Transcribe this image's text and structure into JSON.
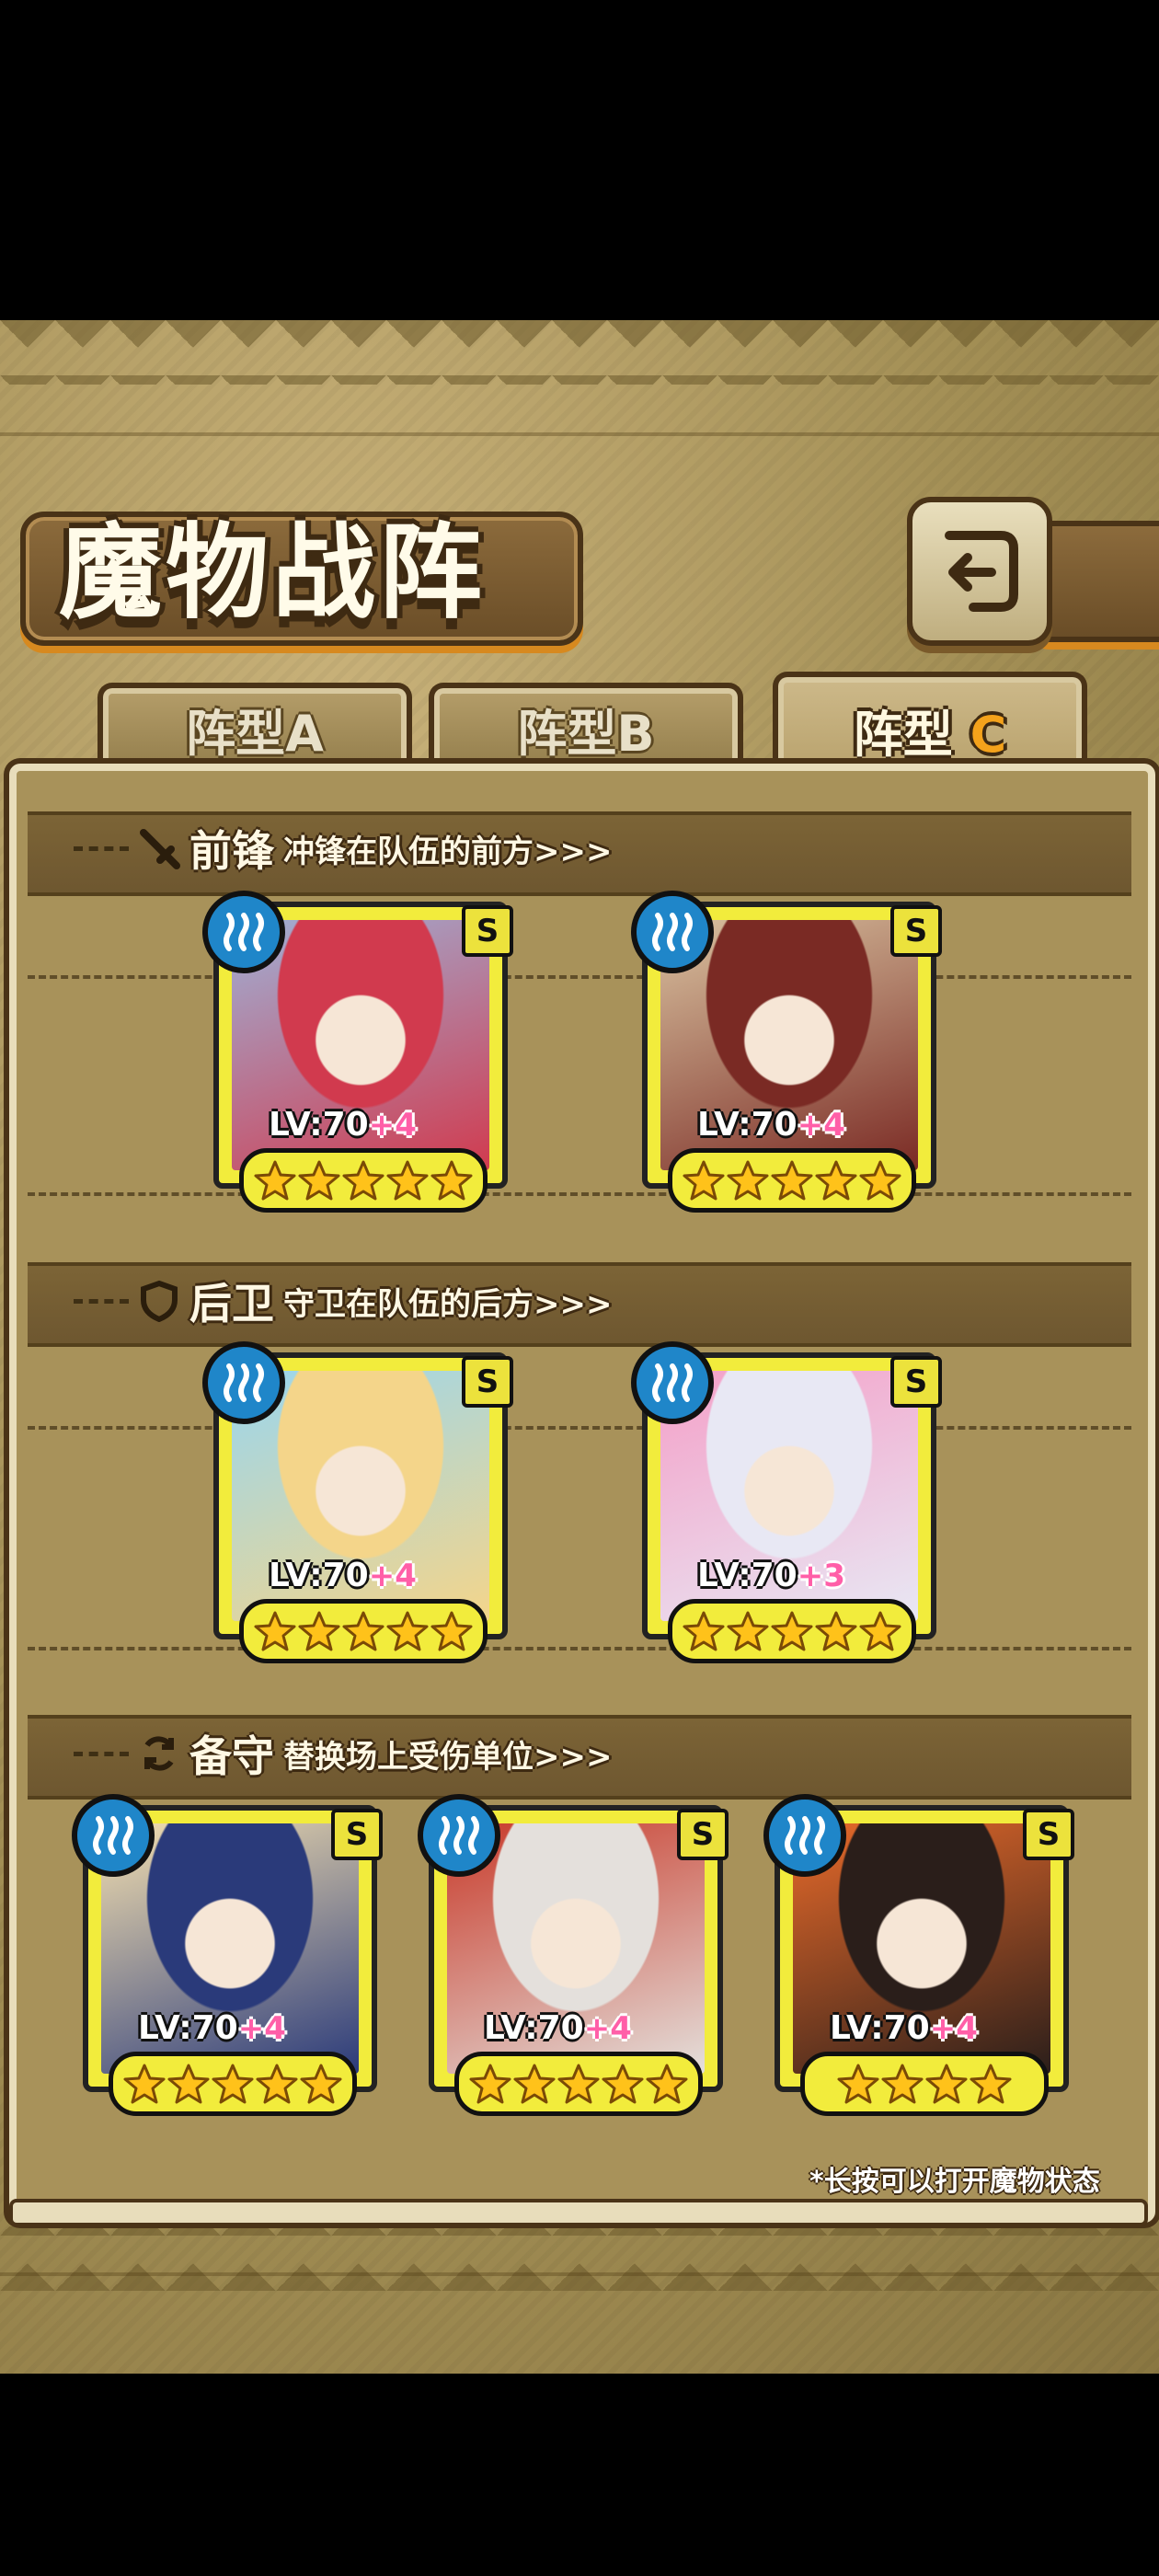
{
  "header": {
    "title": "魔物战阵"
  },
  "tabs": [
    {
      "prefix": "阵型",
      "letter": "A",
      "active": false
    },
    {
      "prefix": "阵型",
      "letter": "B",
      "active": false
    },
    {
      "prefix": "阵型",
      "letter": "C",
      "active": true
    }
  ],
  "sections": {
    "front": {
      "name": "前锋",
      "desc": "冲锋在队伍的前方>>>",
      "icon": "sword-icon"
    },
    "rear": {
      "name": "后卫",
      "desc": "守卫在队伍的后方>>>",
      "icon": "shield-icon"
    },
    "reserve": {
      "name": "备守",
      "desc": "替换场上受伤单位>>>",
      "icon": "swap-icon"
    }
  },
  "cards": {
    "front": [
      {
        "level": "LV:70",
        "bonus": "+4",
        "rank": "S",
        "stars": 5,
        "element": "water-icon",
        "palette": [
          "#d13a4e",
          "#9fb0d6"
        ]
      },
      {
        "level": "LV:70",
        "bonus": "+4",
        "rank": "S",
        "stars": 5,
        "element": "water-icon",
        "palette": [
          "#7a2a24",
          "#d9c2a0"
        ]
      }
    ],
    "rear": [
      {
        "level": "LV:70",
        "bonus": "+4",
        "rank": "S",
        "stars": 5,
        "element": "water-icon",
        "palette": [
          "#f4d58a",
          "#9ad6ee"
        ]
      },
      {
        "level": "LV:70",
        "bonus": "+3",
        "rank": "S",
        "stars": 5,
        "element": "water-icon",
        "palette": [
          "#e8e8f4",
          "#f4a0c8"
        ]
      }
    ],
    "reserve": [
      {
        "level": "LV:70",
        "bonus": "+4",
        "rank": "S",
        "stars": 5,
        "element": "water-icon",
        "palette": [
          "#2a3a7a",
          "#f4e0b0"
        ]
      },
      {
        "level": "LV:70",
        "bonus": "+4",
        "rank": "S",
        "stars": 5,
        "element": "water-icon",
        "palette": [
          "#e4e0dc",
          "#c83a2a"
        ]
      },
      {
        "level": "LV:70",
        "bonus": "+4",
        "rank": "S",
        "stars": 4,
        "element": "water-icon",
        "palette": [
          "#2a1e1a",
          "#e86a2a"
        ]
      }
    ]
  },
  "footer": {
    "hint": "*长按可以打开魔物状态"
  }
}
